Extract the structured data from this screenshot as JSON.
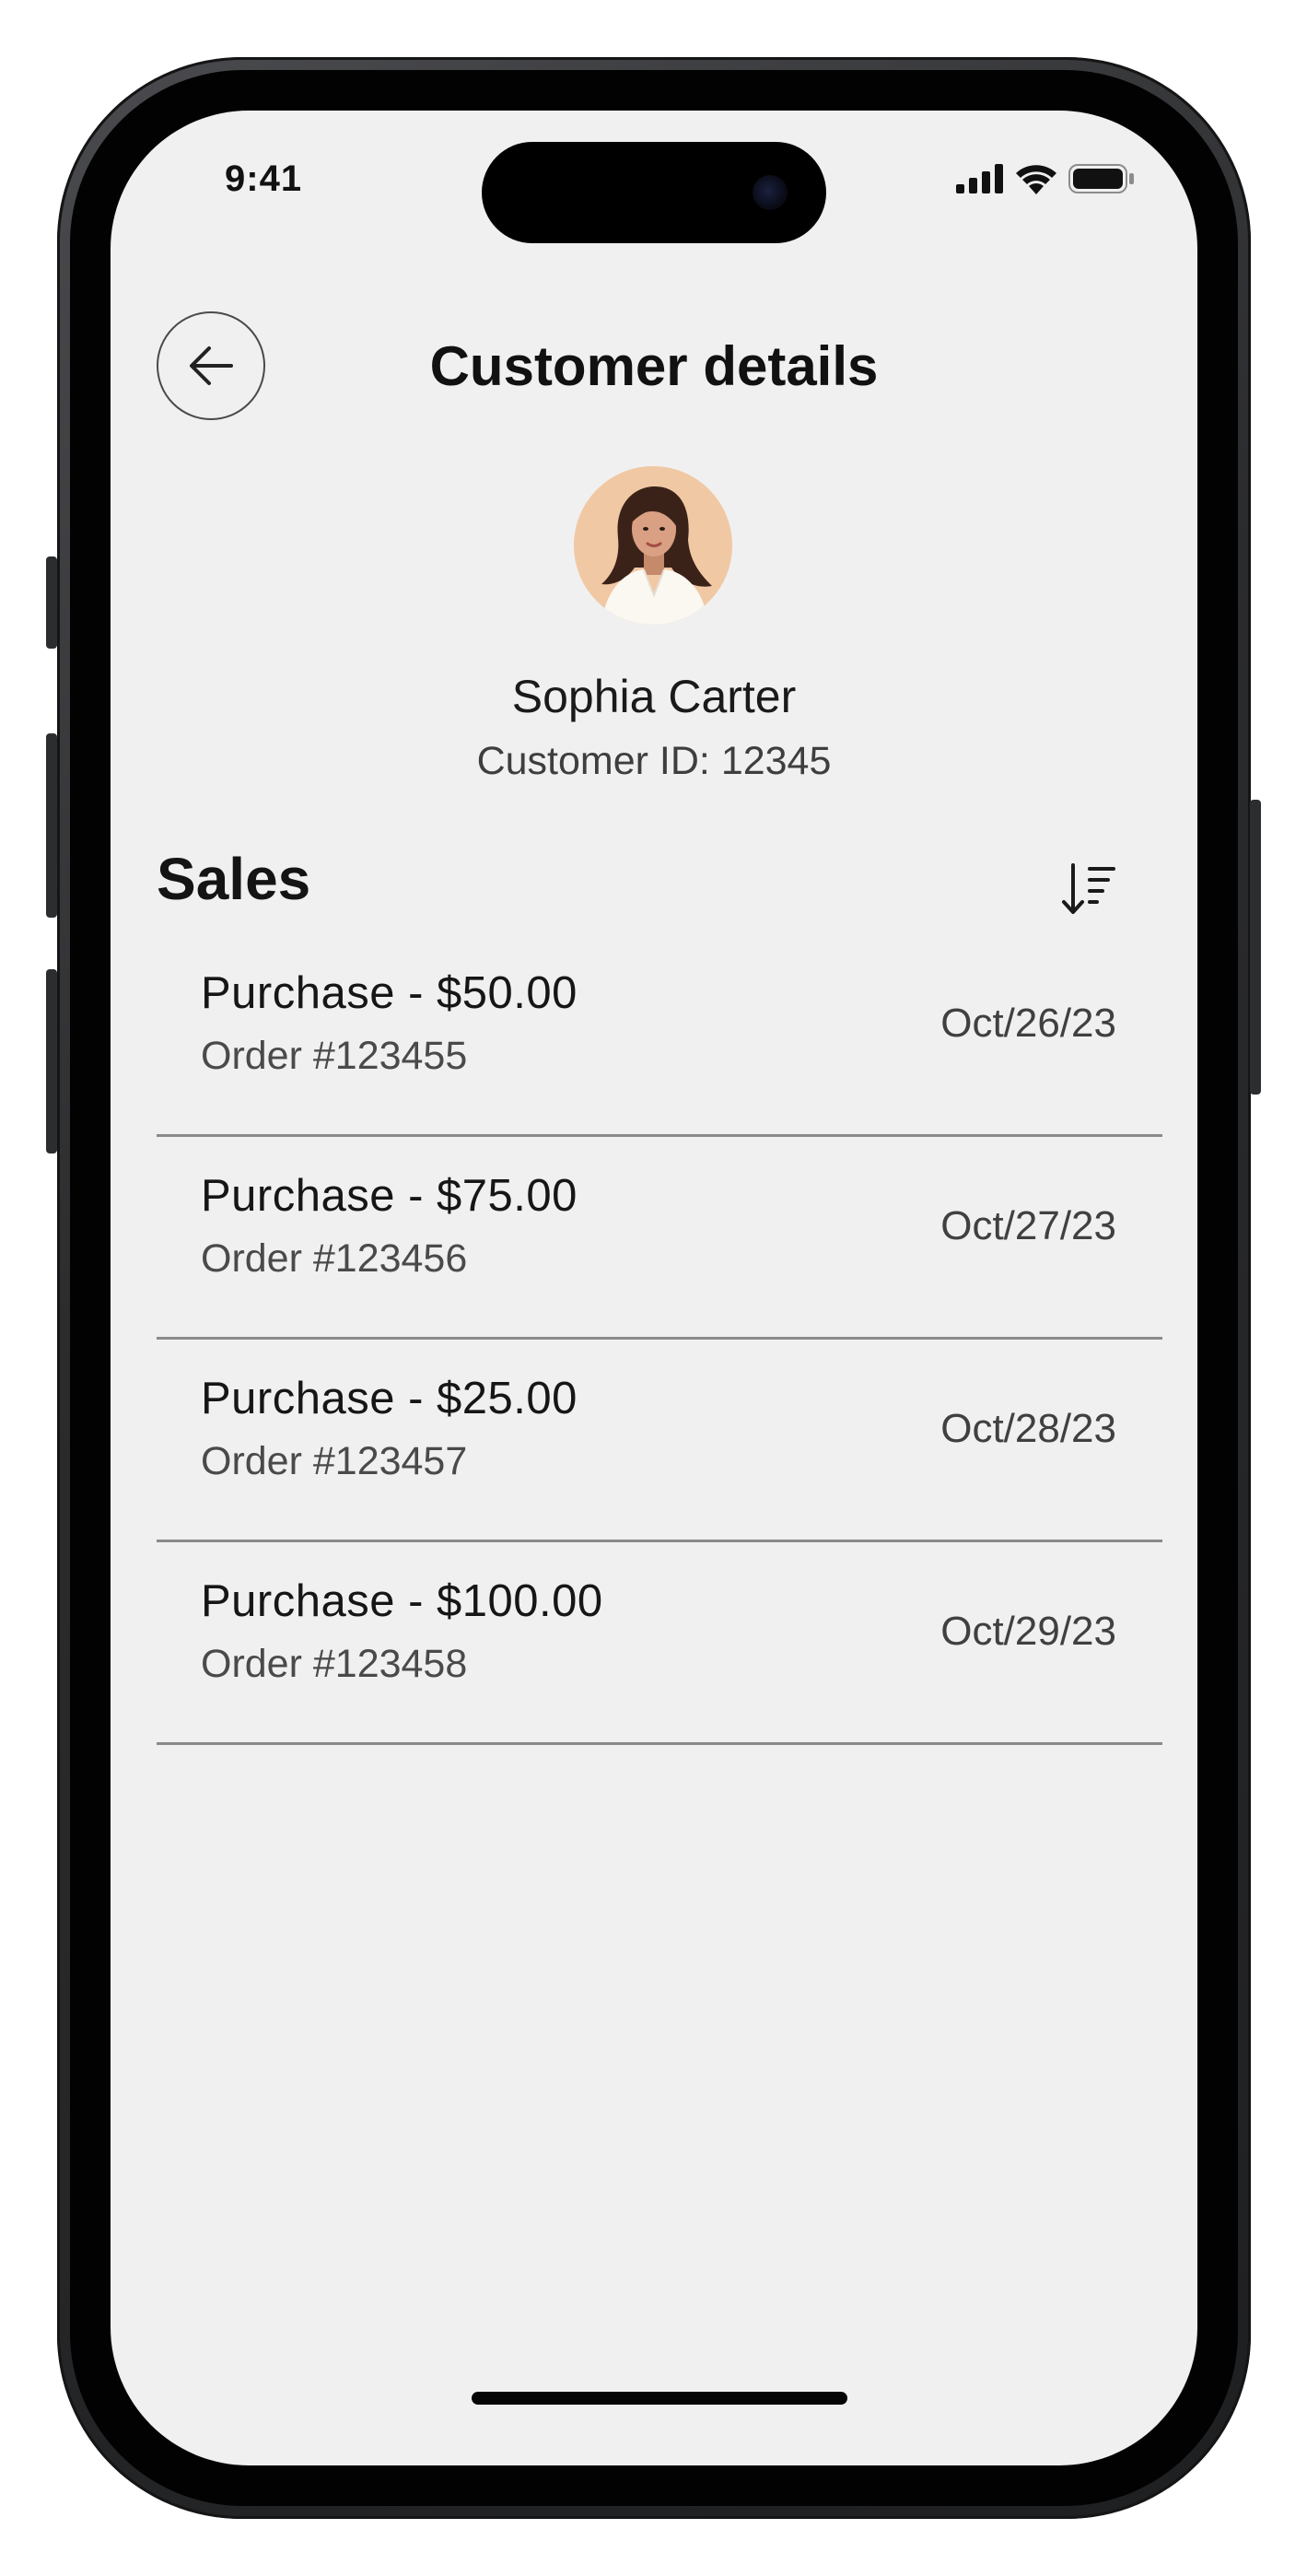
{
  "status_bar": {
    "time": "9:41",
    "signal_icon": "signal-icon",
    "wifi_icon": "wifi-icon",
    "battery_icon": "battery-icon"
  },
  "header": {
    "title": "Customer details",
    "back_icon": "arrow-left-icon"
  },
  "customer": {
    "name": "Sophia Carter",
    "id_text": "Customer ID: 12345",
    "avatar_bg": "#f1c8a4"
  },
  "sales": {
    "title": "Sales",
    "sort_icon": "sort-descending-icon",
    "items": [
      {
        "title": "Purchase - $50.00",
        "order": "Order #123455",
        "date": "Oct/26/23"
      },
      {
        "title": "Purchase - $75.00",
        "order": "Order #123456",
        "date": "Oct/27/23"
      },
      {
        "title": "Purchase - $25.00",
        "order": "Order #123457",
        "date": "Oct/28/23"
      },
      {
        "title": "Purchase - $100.00",
        "order": "Order #123458",
        "date": "Oct/29/23"
      }
    ]
  },
  "colors": {
    "screen_bg": "#f0f0f0",
    "text_primary": "#111111",
    "divider": "#8a8a8a"
  }
}
